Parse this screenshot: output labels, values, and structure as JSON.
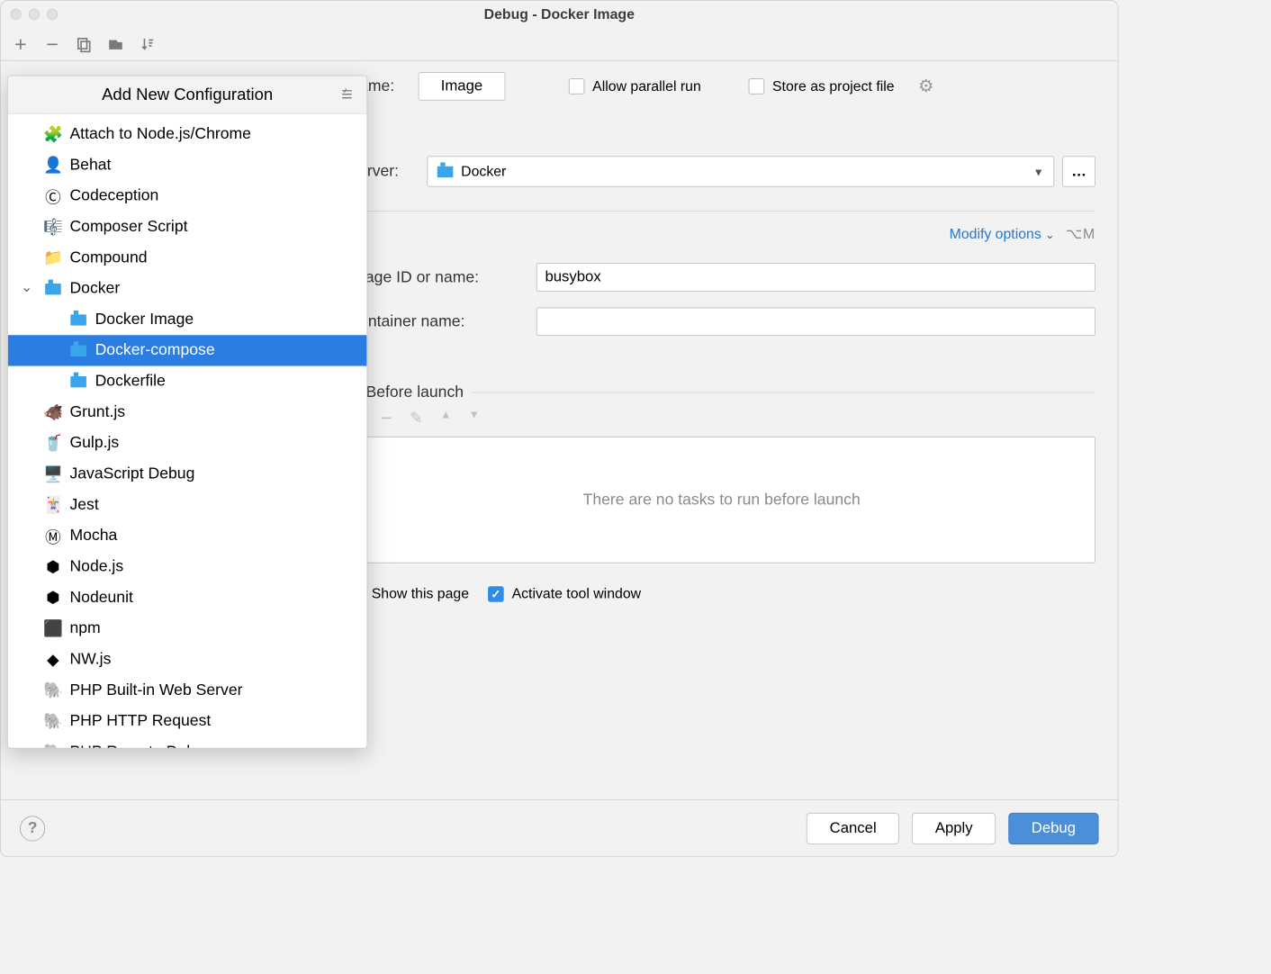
{
  "title": "Debug - Docker Image",
  "toolbar": {
    "add": "+",
    "remove": "−",
    "copy": "⧉",
    "folder": "📁",
    "sort": "↓ª"
  },
  "name_label": "Name:",
  "name_value": "Image",
  "allow_parallel_label": "Allow parallel run",
  "store_project_label": "Store as project file",
  "server_label": "Server:",
  "server_value": "Docker",
  "modify_options": "Modify options",
  "modify_shortcut": "⌥M",
  "image_id_label": "Image ID or name:",
  "image_id_value": "busybox",
  "container_name_label": "Container name:",
  "container_name_value": "",
  "before_launch": "Before launch",
  "no_tasks": "There are no tasks to run before launch",
  "show_page_label": "Show this page",
  "activate_tool_label": "Activate tool window",
  "buttons": {
    "cancel": "Cancel",
    "apply": "Apply",
    "debug": "Debug"
  },
  "popup_title": "Add New Configuration",
  "popup_items": [
    {
      "label": "Attach to Node.js/Chrome",
      "icon": "🧩"
    },
    {
      "label": "Behat",
      "icon": "👤"
    },
    {
      "label": "Codeception",
      "icon": "Ⓒ"
    },
    {
      "label": "Composer Script",
      "icon": "🎼"
    },
    {
      "label": "Compound",
      "icon": "📁"
    },
    {
      "label": "Docker",
      "icon": "docker",
      "parent": true
    },
    {
      "label": "Docker Image",
      "icon": "docker",
      "child": true
    },
    {
      "label": "Docker-compose",
      "icon": "docker",
      "child": true,
      "selected": true
    },
    {
      "label": "Dockerfile",
      "icon": "docker",
      "child": true
    },
    {
      "label": "Grunt.js",
      "icon": "🐗"
    },
    {
      "label": "Gulp.js",
      "icon": "🥤"
    },
    {
      "label": "JavaScript Debug",
      "icon": "🖥️"
    },
    {
      "label": "Jest",
      "icon": "🃏"
    },
    {
      "label": "Mocha",
      "icon": "Ⓜ"
    },
    {
      "label": "Node.js",
      "icon": "⬢"
    },
    {
      "label": "Nodeunit",
      "icon": "⬢"
    },
    {
      "label": "npm",
      "icon": "⬛"
    },
    {
      "label": "NW.js",
      "icon": "◆"
    },
    {
      "label": "PHP Built-in Web Server",
      "icon": "🐘"
    },
    {
      "label": "PHP HTTP Request",
      "icon": "🐘"
    },
    {
      "label": "PHP Remote Debug",
      "icon": "🐘"
    }
  ]
}
